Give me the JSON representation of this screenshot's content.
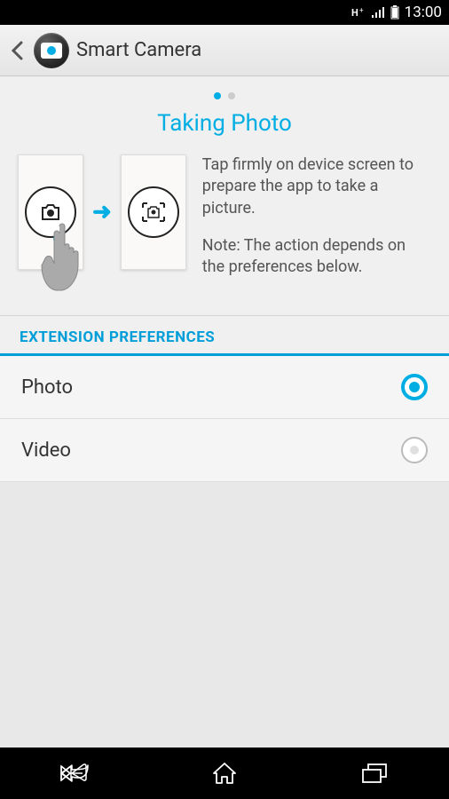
{
  "status": {
    "time": "13:00"
  },
  "appbar": {
    "title": "Smart Camera"
  },
  "pager": {
    "dots": 2,
    "active": 0
  },
  "heading": "Taking Photo",
  "description": {
    "line1": "Tap firmly on device screen to prepare the app to take a picture.",
    "line2": "Note: The action depends on the preferences below."
  },
  "section_title": "EXTENSION PREFERENCES",
  "prefs": {
    "photo": {
      "label": "Photo",
      "selected": true
    },
    "video": {
      "label": "Video",
      "selected": false
    }
  }
}
